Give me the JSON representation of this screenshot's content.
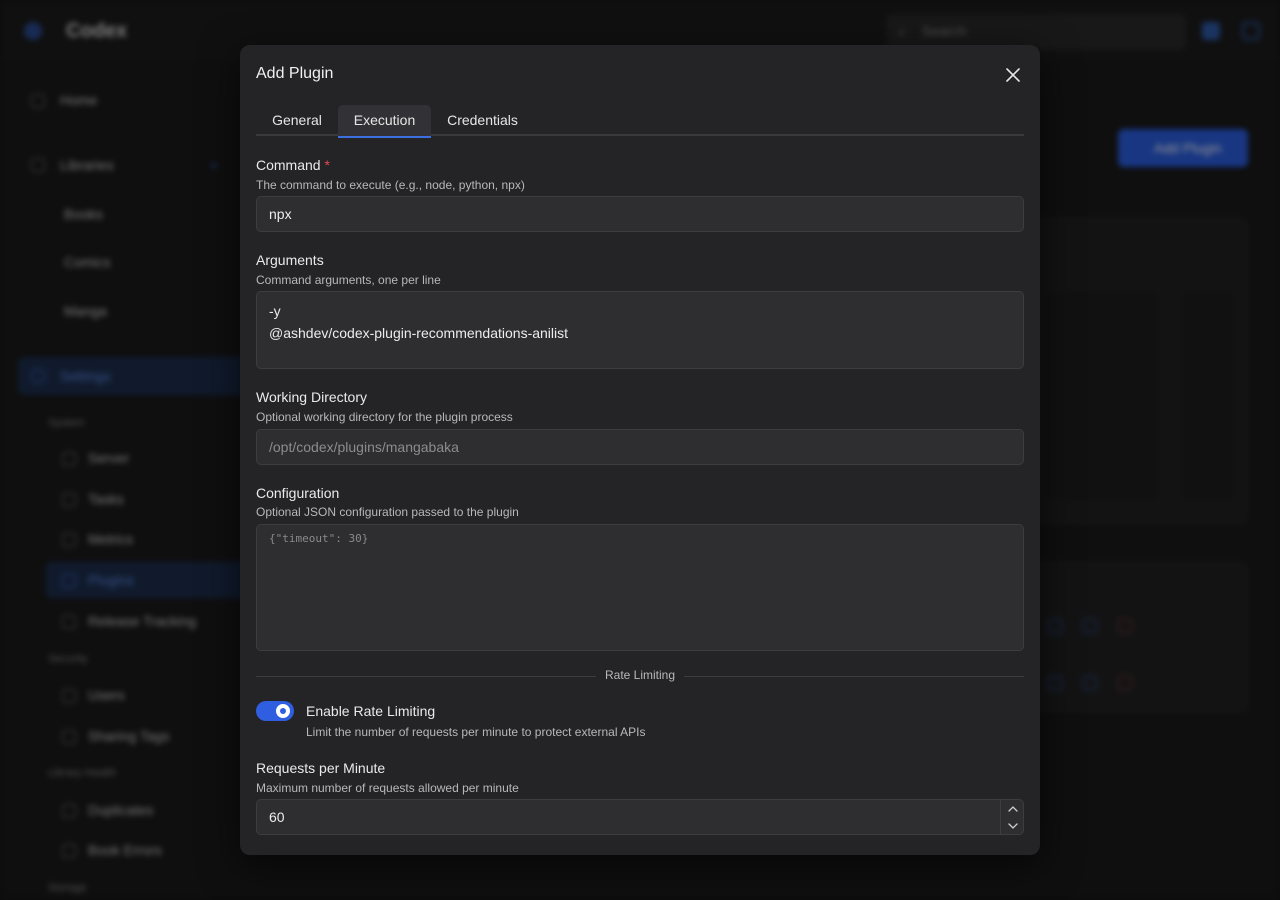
{
  "background": {
    "app_name": "Codex",
    "search_placeholder": "Search",
    "nav": {
      "home": "Home",
      "libraries": "Libraries",
      "books": "Books",
      "comics": "Comics",
      "manga": "Manga",
      "settings": "Settings",
      "section_system": "System",
      "server": "Server",
      "tasks": "Tasks",
      "metrics": "Metrics",
      "plugins": "Plugins",
      "release_tracking": "Release Tracking",
      "section_security": "Security",
      "users": "Users",
      "sharing_tags": "Sharing Tags",
      "section_library_health": "Library Health",
      "duplicates": "Duplicates",
      "book_errors": "Book Errors",
      "section_storage": "Storage"
    },
    "add_plugin_button": "Add Plugin"
  },
  "modal": {
    "title": "Add Plugin",
    "tabs": [
      {
        "label": "General"
      },
      {
        "label": "Execution"
      },
      {
        "label": "Credentials"
      }
    ],
    "command": {
      "label": "Command",
      "required_mark": "*",
      "description": "The command to execute (e.g., node, python, npx)",
      "value": "npx"
    },
    "arguments": {
      "label": "Arguments",
      "description": "Command arguments, one per line",
      "value": "-y\n@ashdev/codex-plugin-recommendations-anilist"
    },
    "working_directory": {
      "label": "Working Directory",
      "description": "Optional working directory for the plugin process",
      "placeholder": "/opt/codex/plugins/mangabaka"
    },
    "configuration": {
      "label": "Configuration",
      "description": "Optional JSON configuration passed to the plugin",
      "placeholder": "{\"timeout\": 30}"
    },
    "rate_limiting": {
      "section_label": "Rate Limiting",
      "toggle_label": "Enable Rate Limiting",
      "toggle_description": "Limit the number of requests per minute to protect external APIs",
      "enabled": true
    },
    "requests_per_minute": {
      "label": "Requests per Minute",
      "description": "Maximum number of requests allowed per minute",
      "value": "60"
    }
  },
  "colors": {
    "accent": "#2f5fe0",
    "required": "#e5484d",
    "modal_bg": "#242426"
  }
}
